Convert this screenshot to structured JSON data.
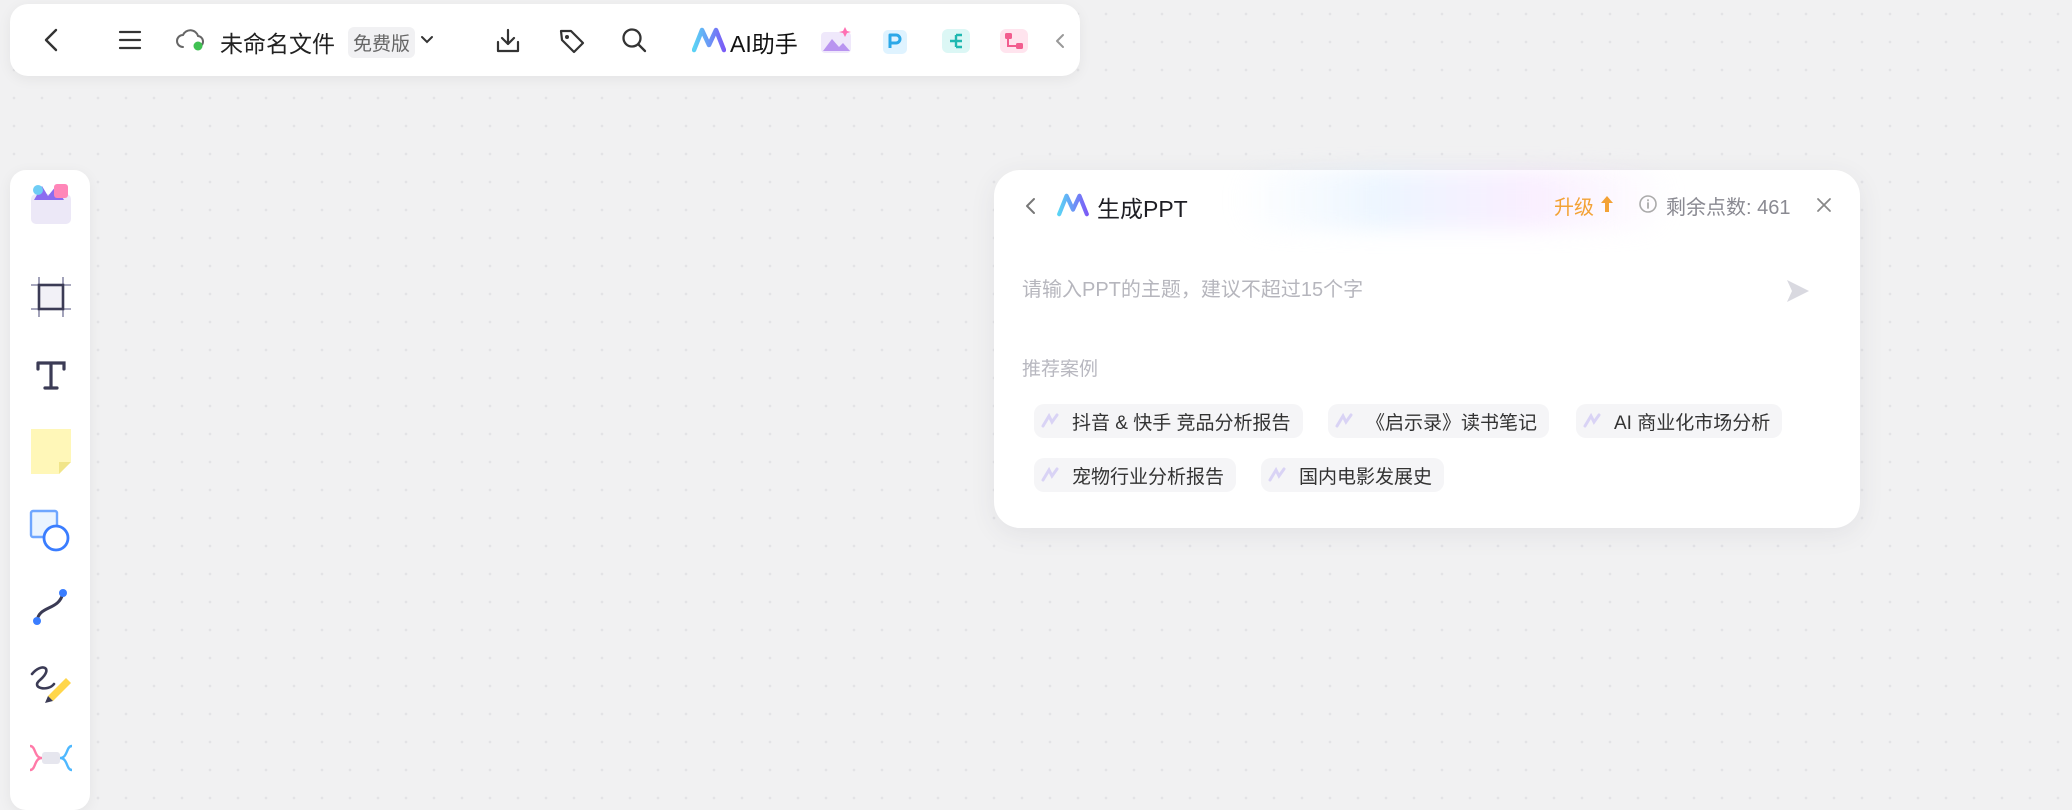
{
  "topbar": {
    "file_name": "未命名文件",
    "plan_label": "免费版",
    "ai_assistant_label": "AI助手",
    "icons": [
      "back-arrow-icon",
      "menu-icon",
      "cloud-sync-icon",
      "chevron-down-icon",
      "download-icon",
      "tag-icon",
      "search-icon",
      "ai-logo-icon",
      "image-gen-icon",
      "ppt-icon",
      "mindmap-icon",
      "flowchart-icon",
      "collapse-icon"
    ]
  },
  "left_toolbar": {
    "tools": [
      "template-icon",
      "frame-icon",
      "text-icon",
      "sticky-note-icon",
      "shape-icon",
      "connector-icon",
      "pen-icon",
      "mindmap-icon"
    ]
  },
  "ppt_panel": {
    "title": "生成PPT",
    "upgrade_label": "升级",
    "points_label": "剩余点数: 461",
    "input_placeholder": "请输入PPT的主题，建议不超过15个字",
    "recommend_label": "推荐案例",
    "examples": [
      "抖音 & 快手 竞品分析报告",
      "《启示录》读书笔记",
      "AI 商业化市场分析",
      "宠物行业分析报告",
      "国内电影发展史"
    ]
  },
  "colors": {
    "accent_orange": "#f3a235",
    "canvas_bg": "#f1f1f2",
    "brand_purple": "#7b5cf6",
    "brand_cyan": "#5ad3f5"
  }
}
